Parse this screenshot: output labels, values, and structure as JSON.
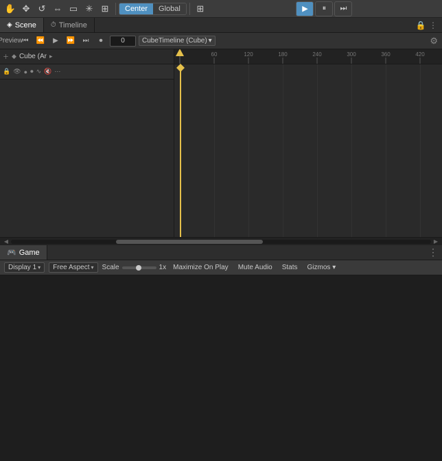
{
  "topToolbar": {
    "icons": [
      "hand",
      "move",
      "rotate",
      "scale",
      "rect",
      "custom",
      "grid",
      "center",
      "global",
      "dots"
    ],
    "centerToggle": {
      "left": "Center",
      "right": "Global"
    },
    "playControls": {
      "play": "▶",
      "pause": "⏸",
      "step": "⏭"
    }
  },
  "sceneTabs": {
    "tabs": [
      {
        "id": "scene",
        "label": "Scene",
        "icon": "◈"
      },
      {
        "id": "timeline",
        "label": "Timeline",
        "icon": "⏱"
      }
    ],
    "active": "scene"
  },
  "timelineControls": {
    "previewLabel": "Preview",
    "timeValue": "0",
    "dropdownLabel": "CubeTimeline (Cube)"
  },
  "timelineTrack": {
    "name": "Cube (Ar",
    "rulerLabels": [
      "60",
      "120",
      "180",
      "240",
      "300",
      "360",
      "420"
    ]
  },
  "gamePanel": {
    "tabLabel": "Game",
    "tabIcon": "🎮",
    "displayLabel": "Display 1",
    "aspectLabel": "Free Aspect",
    "scaleLabel": "Scale",
    "scaleValue": "1x",
    "maximizeLabel": "Maximize On Play",
    "muteLabel": "Mute Audio",
    "statsLabel": "Stats",
    "gizmosLabel": "Gizmos"
  }
}
